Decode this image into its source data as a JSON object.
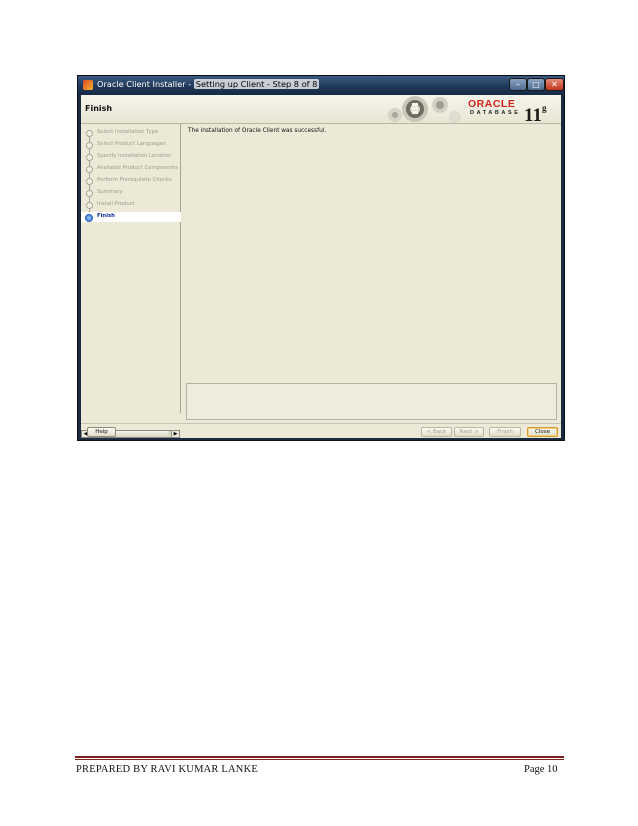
{
  "window": {
    "title_prefix": "Oracle Client Installer - ",
    "title_highlight": "Setting up Client - Step 8 of 8",
    "minimize_glyph": "–",
    "maximize_glyph": "□",
    "close_glyph": "✕"
  },
  "header": {
    "step_title": "Finish",
    "logo_brand": "ORACLE",
    "logo_product": "DATABASE",
    "logo_version": "11",
    "logo_version_suffix": "g"
  },
  "nav": {
    "items": [
      {
        "label": "Select Installation Type",
        "state": "done"
      },
      {
        "label": "Select Product Languages",
        "state": "done"
      },
      {
        "label": "Specify Installation Location",
        "state": "done"
      },
      {
        "label": "Available Product Components",
        "state": "done"
      },
      {
        "label": "Perform Prerequisite Checks",
        "state": "done"
      },
      {
        "label": "Summary",
        "state": "done"
      },
      {
        "label": "Install Product",
        "state": "done"
      },
      {
        "label": "Finish",
        "state": "active"
      }
    ],
    "scroll_left_glyph": "◀",
    "scroll_right_glyph": "▶"
  },
  "content": {
    "message": "The installation of Oracle Client was successful."
  },
  "buttons": {
    "help": "Help",
    "back": "< Back",
    "next": "Next >",
    "finish": "Finish",
    "close": "Close"
  },
  "page_footer": {
    "left": "PREPARED BY RAVI KUMAR LANKE",
    "right": "Page 10",
    "rule_color": "#7d1f1a"
  },
  "colors": {
    "window_bg": "#ecead7",
    "oracle_red": "#d2261c",
    "active_step": "#0b2f9a"
  }
}
